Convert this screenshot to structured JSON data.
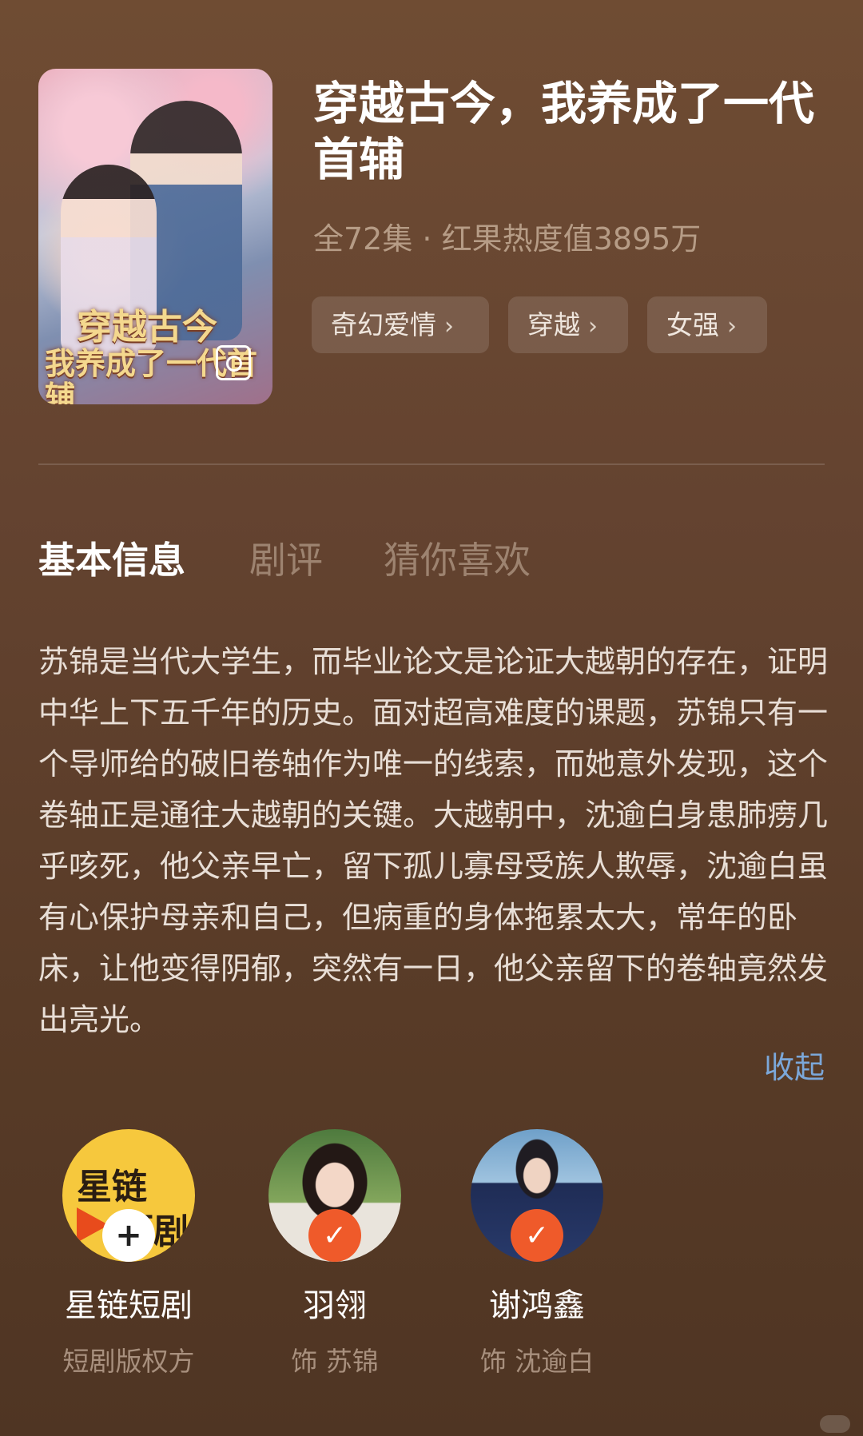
{
  "drama": {
    "title": "穿越古今，我养成了一代首辅",
    "meta": "全72集 · 红果热度值3895万",
    "poster_title_line1": "穿越古今",
    "poster_title_line2": "我养成了一代首辅",
    "tags": [
      {
        "label": "奇幻爱情",
        "chevron": "›"
      },
      {
        "label": "穿越",
        "chevron": "›"
      },
      {
        "label": "女强",
        "chevron": "›"
      }
    ]
  },
  "tabs": [
    {
      "label": "基本信息",
      "active": true
    },
    {
      "label": "剧评",
      "active": false
    },
    {
      "label": "猜你喜欢",
      "active": false
    }
  ],
  "synopsis": "苏锦是当代大学生，而毕业论文是论证大越朝的存在，证明中华上下五千年的历史。面对超高难度的课题，苏锦只有一个导师给的破旧卷轴作为唯一的线索，而她意外发现，这个卷轴正是通往大越朝的关键。大越朝中，沈逾白身患肺痨几乎咳死，他父亲早亡，留下孤儿寡母受族人欺辱，沈逾白虽有心保护母亲和自己，但病重的身体拖累太大，常年的卧床，让他变得阴郁，突然有一日，他父亲留下的卷轴竟然发出亮光。",
  "collapse_label": "收起",
  "cast": [
    {
      "name": "星链短剧",
      "role": "短剧版权方",
      "avatar_text_1": "星链",
      "avatar_text_2": "短剧",
      "badge": "+",
      "badge_icon": "plus-icon"
    },
    {
      "name": "羽翎",
      "role": "饰 苏锦",
      "badge": "✓",
      "badge_icon": "check-icon"
    },
    {
      "name": "谢鸿鑫",
      "role": "饰 沈逾白",
      "badge": "✓",
      "badge_icon": "check-icon"
    }
  ],
  "colors": {
    "accent_link": "#7ba7d9",
    "follow_badge": "#ef5a2a",
    "background_top": "#6f4c33",
    "background_bottom": "#4f3523"
  }
}
